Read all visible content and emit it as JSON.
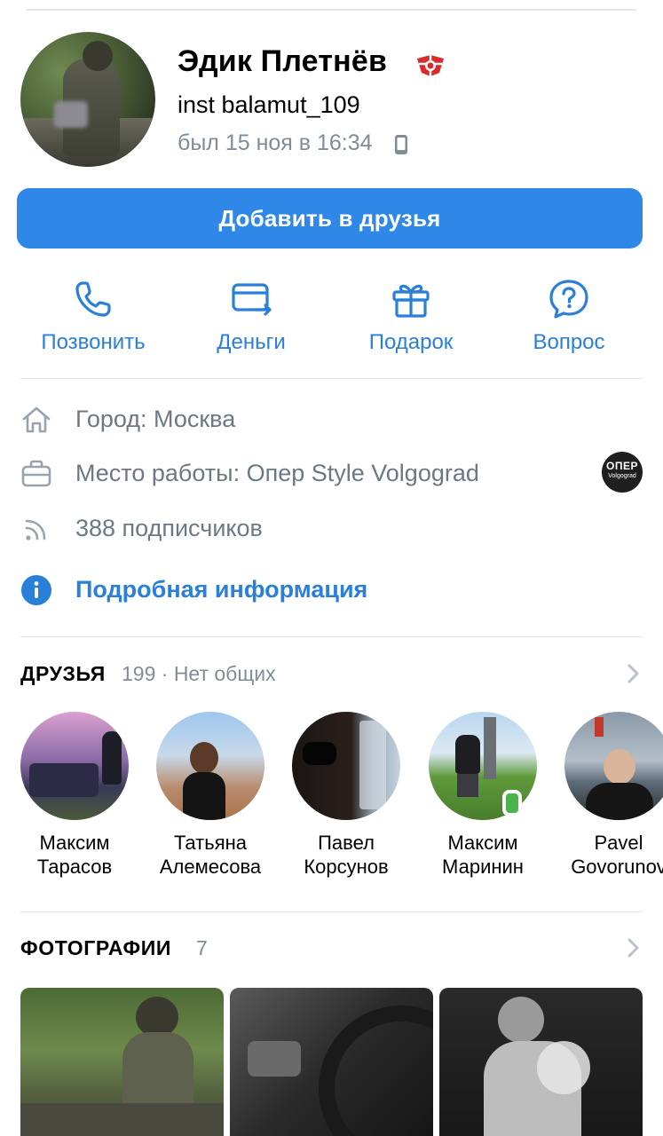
{
  "profile": {
    "name": "Эдик Плетнёв",
    "status": "inst balamut_109",
    "last_seen": "был 15 ноя в 16:34"
  },
  "add_friend_label": "Добавить в друзья",
  "actions": [
    {
      "label": "Позвонить",
      "icon": "phone-icon"
    },
    {
      "label": "Деньги",
      "icon": "money-transfer-icon"
    },
    {
      "label": "Подарок",
      "icon": "gift-icon"
    },
    {
      "label": "Вопрос",
      "icon": "question-icon"
    }
  ],
  "info": {
    "city": "Город: Москва",
    "work": "Место работы: Опер Style Volgograd",
    "work_logo_top": "ОПЕР",
    "work_logo_bottom": "Volgograd",
    "followers": "388 подписчиков",
    "details": "Подробная информация"
  },
  "friends_section": {
    "title": "ДРУЗЬЯ",
    "meta": "199 · Нет общих",
    "items": [
      {
        "first": "Максим",
        "last": "Тарасов"
      },
      {
        "first": "Татьяна",
        "last": "Алемесова"
      },
      {
        "first": "Павел",
        "last": "Корсунов"
      },
      {
        "first": "Максим",
        "last": "Маринин"
      },
      {
        "first": "Pavel",
        "last": "Govorunov"
      }
    ]
  },
  "photos_section": {
    "title": "ФОТОГРАФИИ",
    "count": "7"
  },
  "colors": {
    "accent": "#2f87e8",
    "link": "#2a7fd9",
    "secondary_text": "#818c99",
    "online": "#4bb34b"
  }
}
